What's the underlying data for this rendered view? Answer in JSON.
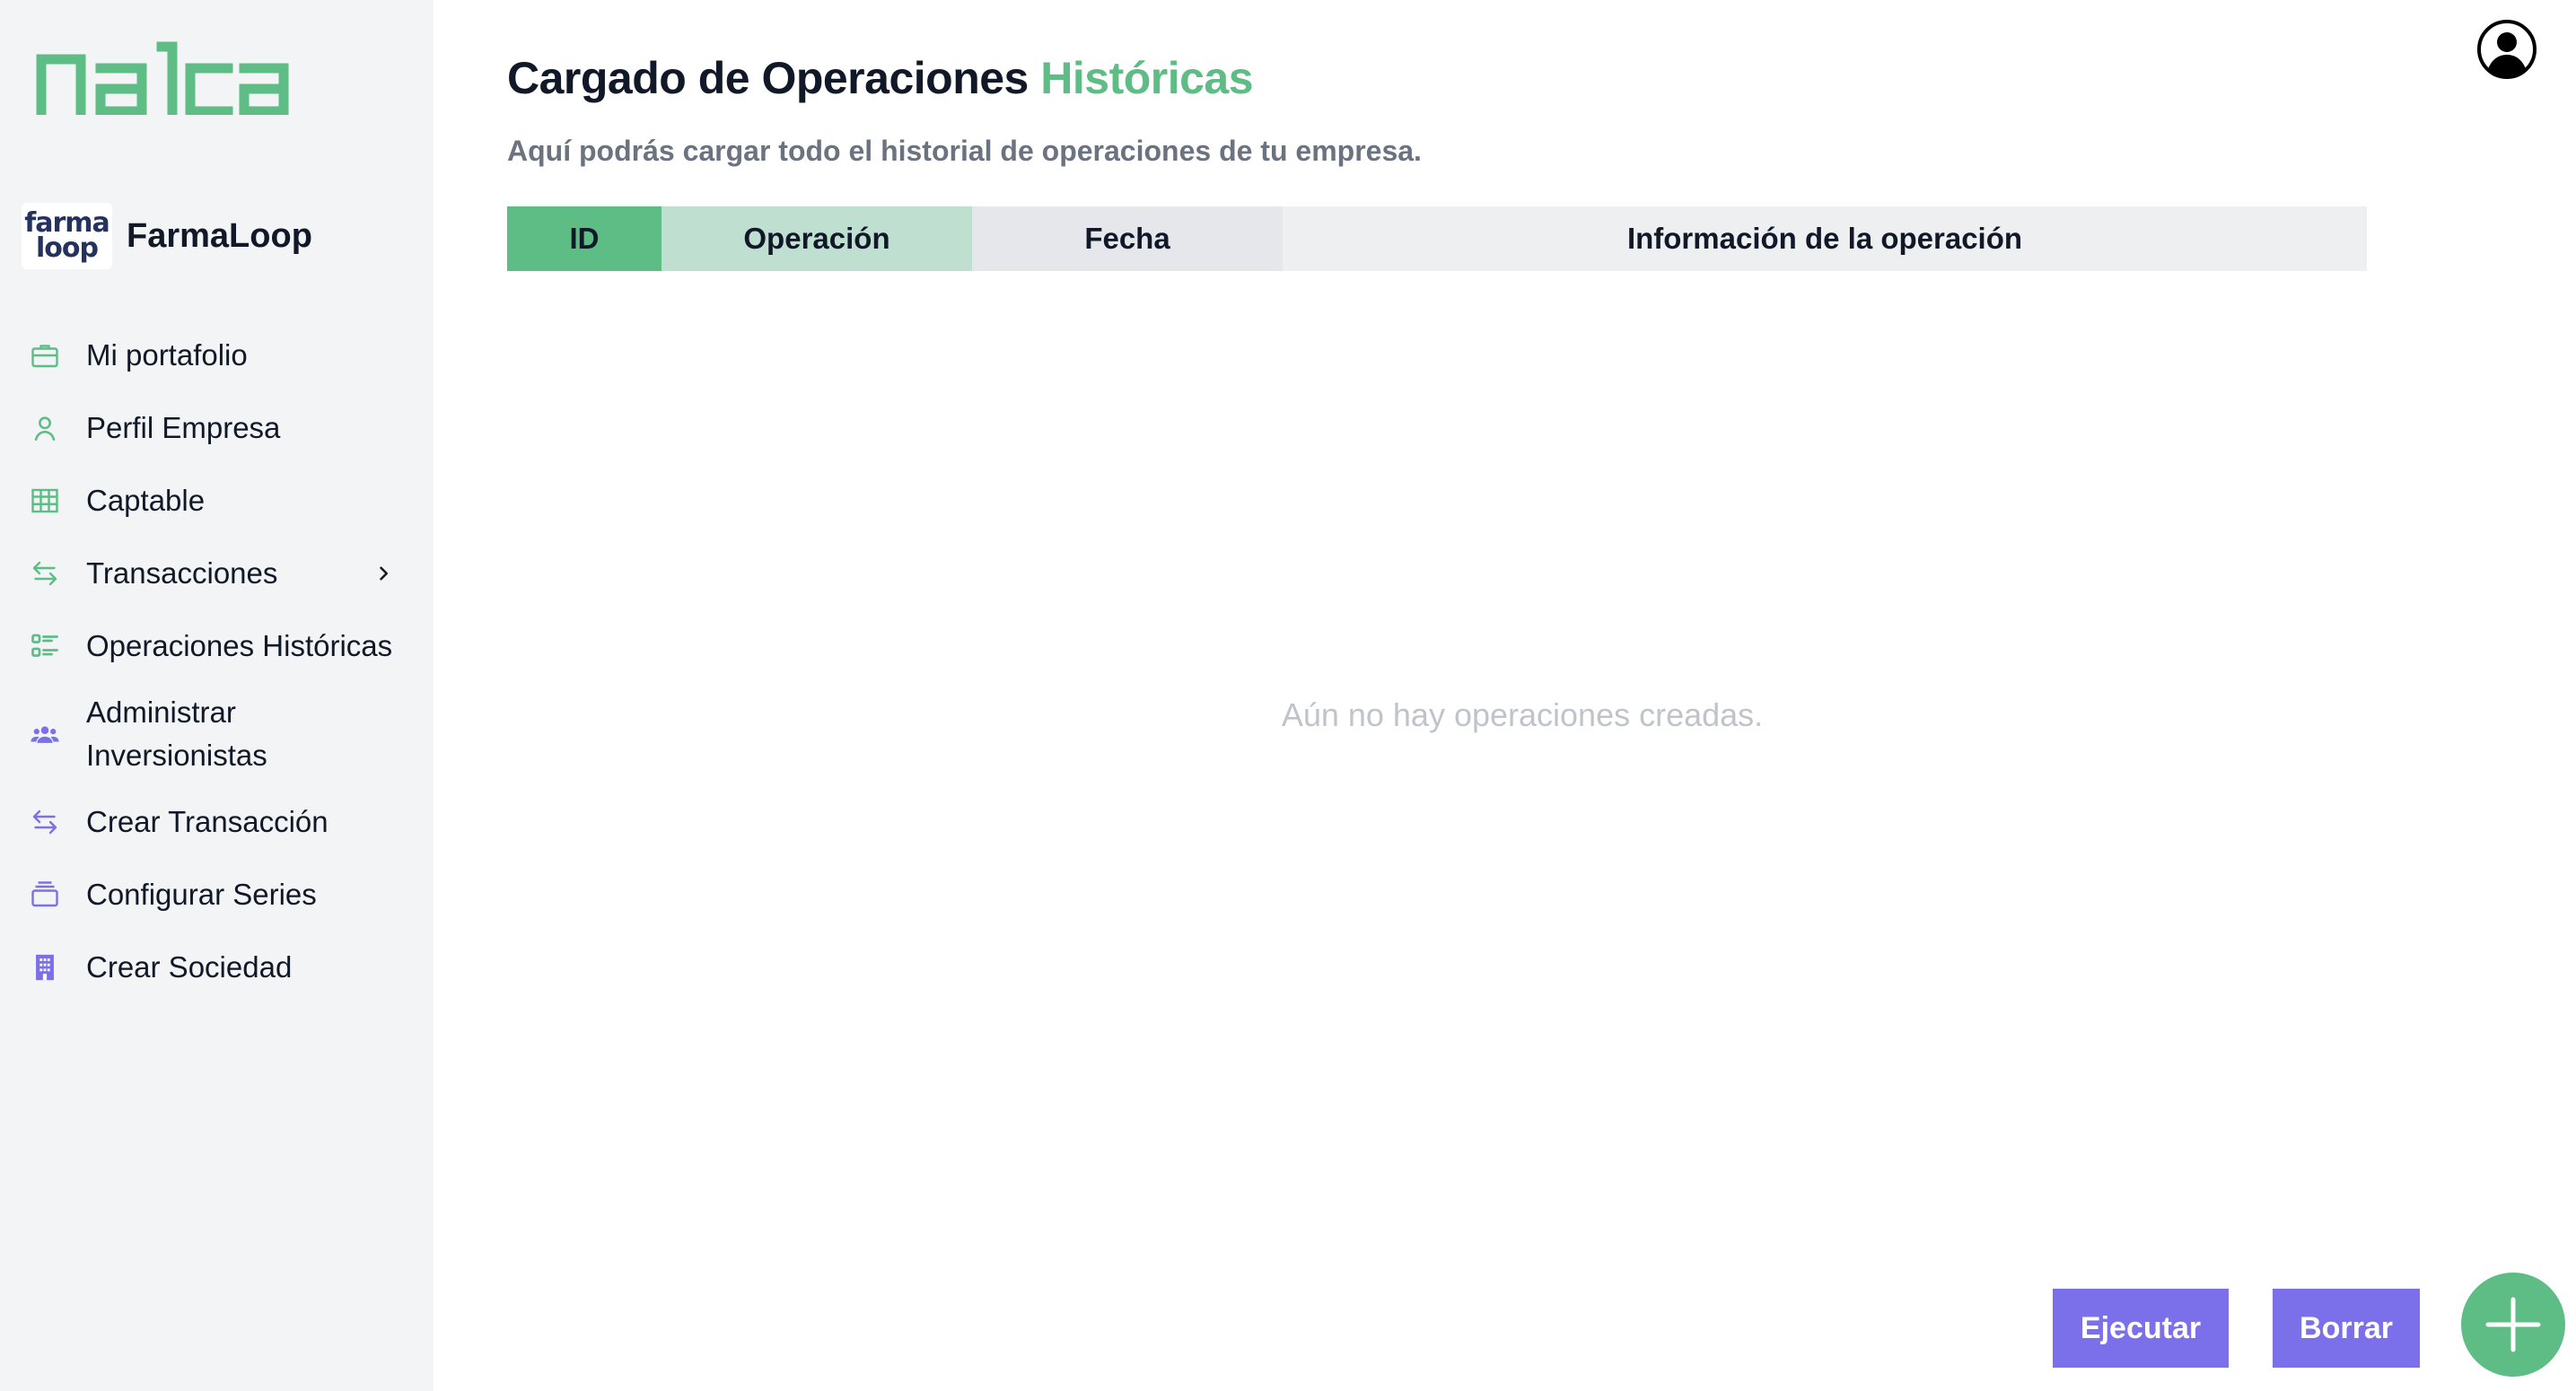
{
  "brand": {
    "logo_text": "nalca"
  },
  "company": {
    "logo_line1": "farma",
    "logo_line2": "loop",
    "name": "FarmaLoop"
  },
  "sidebar": {
    "items": [
      {
        "label": "Mi portafolio",
        "icon": "briefcase-icon"
      },
      {
        "label": "Perfil Empresa",
        "icon": "user-icon"
      },
      {
        "label": "Captable",
        "icon": "table-icon"
      },
      {
        "label": "Transacciones",
        "icon": "arrows-exchange-icon",
        "has_submenu": true
      },
      {
        "label": "Operaciones Históricas",
        "icon": "list-check-icon"
      },
      {
        "label": "Administrar Inversionistas",
        "label_line1": "Administrar",
        "label_line2": "Inversionistas",
        "icon": "users-group-icon"
      },
      {
        "label": "Crear Transacción",
        "icon": "arrows-exchange-icon"
      },
      {
        "label": "Configurar Series",
        "icon": "layers-icon"
      },
      {
        "label": "Crear Sociedad",
        "icon": "building-icon"
      }
    ]
  },
  "page": {
    "title_main": "Cargado de Operaciones",
    "title_accent": "Históricas",
    "subtitle": "Aquí podrás cargar todo el historial de operaciones de tu empresa."
  },
  "table": {
    "columns": [
      "ID",
      "Operación",
      "Fecha",
      "Información de la operación"
    ],
    "empty_message": "Aún no hay operaciones creadas."
  },
  "actions": {
    "execute_label": "Ejecutar",
    "delete_label": "Borrar",
    "add_icon": "plus-icon",
    "user_icon": "user-circle-icon"
  },
  "colors": {
    "accent_green": "#5ebc85",
    "accent_purple": "#7b70ea",
    "sidebar_bg": "#f3f4f6",
    "id_header_bg": "#5ebc85",
    "op_header_bg": "#bfe0d1",
    "fecha_header_bg": "#e5e7eb",
    "info_header_bg": "#eeeff1"
  }
}
